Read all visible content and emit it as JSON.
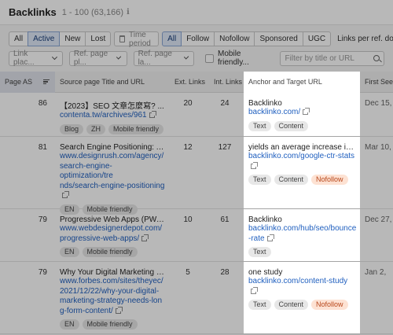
{
  "header": {
    "title": "Backlinks",
    "range": "1 - 100 (63,166)",
    "info_icon": "info-icon"
  },
  "filters_row1": {
    "status_tabs": [
      "All",
      "Active",
      "New",
      "Lost"
    ],
    "active_status": "Active",
    "time_period": "Time period",
    "follow_tabs": [
      "All",
      "Follow",
      "Nofollow",
      "Sponsored",
      "UGC"
    ],
    "active_follow": "All",
    "links_per_domain": "Links per ref. domain"
  },
  "filters_row2": {
    "dropdowns": [
      "Link plac...",
      "Ref. page pl...",
      "Ref. page la..."
    ],
    "checkbox_label": "Mobile friendly...",
    "search_placeholder": "Filter by title or URL"
  },
  "table": {
    "columns": [
      "Page AS",
      "Source page Title and URL",
      "Ext. Links",
      "Int. Links",
      "Anchor and Target URL",
      "First Seen"
    ],
    "rows": [
      {
        "page_as": "86",
        "source_title": "【2023】SEO 文章怎麼寫? ...",
        "source_url": [
          "contenta.tw/archives/961"
        ],
        "source_tags": [
          "Blog",
          "ZH",
          "Mobile friendly"
        ],
        "ext": "20",
        "int": "24",
        "anchor": "Backlinko",
        "target_url": [
          "backlinko.com/"
        ],
        "target_tags": [
          "Text",
          "Content"
        ],
        "first_seen": "Dec 15,"
      },
      {
        "page_as": "81",
        "source_title": "Search Engine Positioning: All...",
        "source_url": [
          "www.designrush.com/agency/",
          "search-engine-optimization/tre",
          "nds/search-engine-positioning"
        ],
        "source_tags": [
          "EN",
          "Mobile friendly"
        ],
        "ext": "12",
        "int": "127",
        "anchor": "yields an average increase in ...",
        "target_url": [
          "backlinko.com/google-ctr-stats"
        ],
        "target_tags": [
          "Text",
          "Content",
          "Nofollow"
        ],
        "first_seen": "Mar 10,"
      },
      {
        "page_as": "79",
        "source_title": "Progressive Web Apps (PWAs...",
        "source_url": [
          "www.webdesignerdepot.com/",
          "progressive-web-apps/"
        ],
        "source_tags": [
          "EN",
          "Mobile friendly"
        ],
        "ext": "10",
        "int": "61",
        "anchor": "Backlinko",
        "target_url": [
          "backlinko.com/hub/seo/bounce",
          "-rate"
        ],
        "target_tags": [
          "Text"
        ],
        "first_seen": "Dec 27,"
      },
      {
        "page_as": "79",
        "source_title": "Why Your Digital Marketing S...",
        "source_url": [
          "www.forbes.com/sites/theyec/",
          "2021/12/22/why-your-digital-",
          "marketing-strategy-needs-lon",
          "g-form-content/"
        ],
        "source_tags": [
          "EN",
          "Mobile friendly"
        ],
        "ext": "5",
        "int": "28",
        "anchor": "one study",
        "target_url": [
          "backlinko.com/content-study"
        ],
        "target_tags": [
          "Text",
          "Content",
          "Nofollow"
        ],
        "first_seen": "Jan 2,"
      }
    ]
  }
}
